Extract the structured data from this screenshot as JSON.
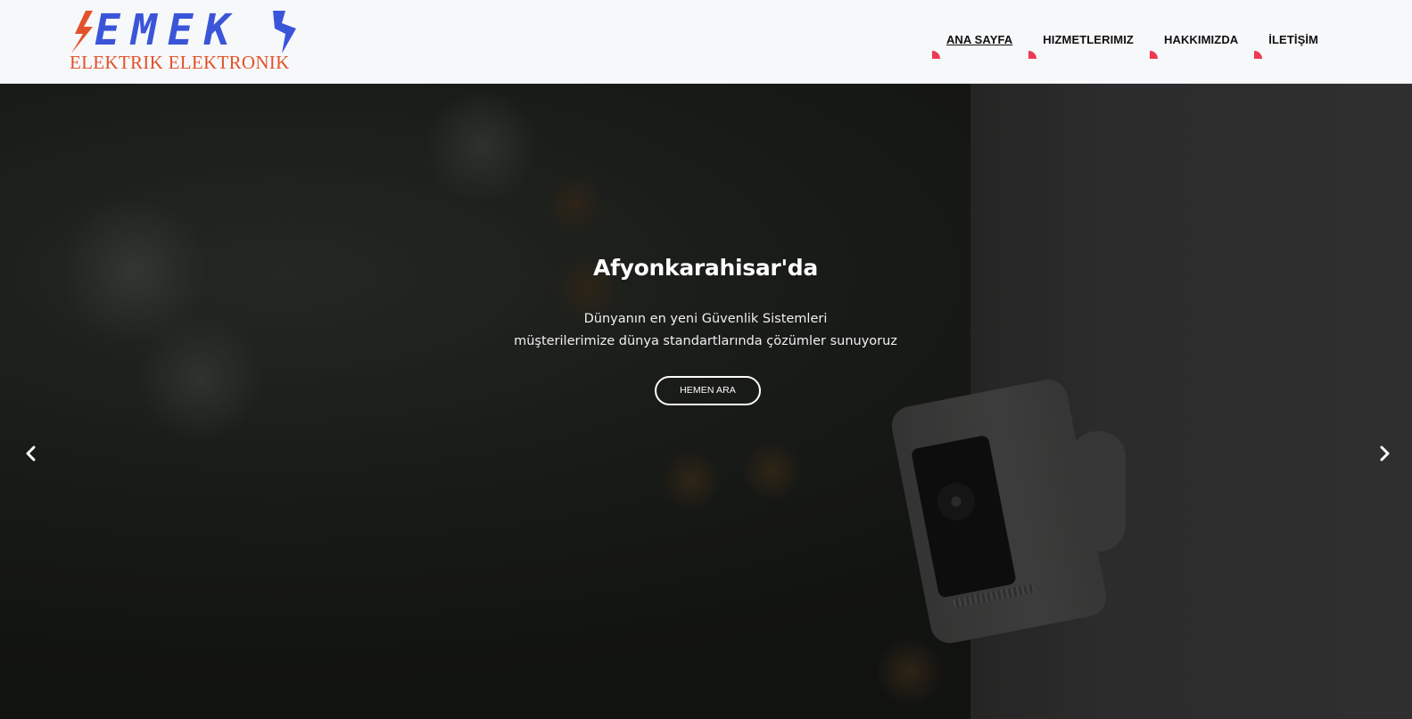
{
  "brand": {
    "name": "EMEK",
    "tagline": "ELEKTRIK ELEKTRONIK",
    "colors": {
      "blue": "#3b55d9",
      "orange": "#e2522a"
    },
    "icon": "lightning-bolt-icon"
  },
  "nav": {
    "items": [
      {
        "label": "ANA SAYFA",
        "active": true
      },
      {
        "label": "HIZMETLERIMIZ",
        "active": false
      },
      {
        "label": "HAKKIMIZDA",
        "active": false
      },
      {
        "label": "İLETİŞİM",
        "active": false
      }
    ],
    "accent": "#ec3b52"
  },
  "hero": {
    "title": "Afyonkarahisar'da",
    "line1": "Dünyanın en yeni Güvenlik Sistemleri",
    "line2": "müşterilerimize dünya standartlarında çözümler sunuyoruz",
    "cta": "HEMEN ARA",
    "prev_icon": "chevron-left-icon",
    "next_icon": "chevron-right-icon"
  }
}
